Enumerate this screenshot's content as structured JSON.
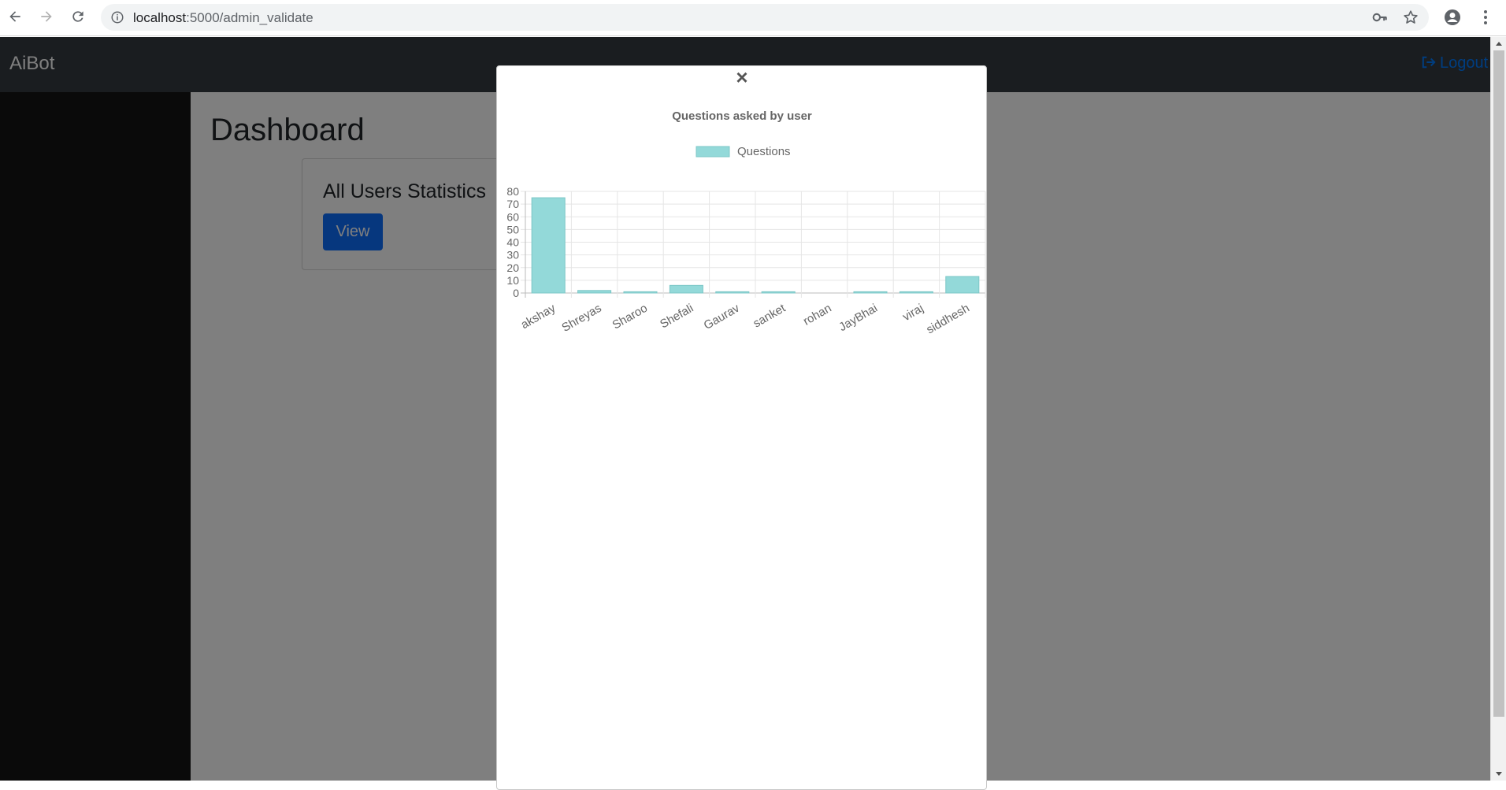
{
  "browser": {
    "url_host": "localhost",
    "url_path": ":5000/admin_validate"
  },
  "navbar": {
    "brand": "AiBot",
    "logout_label": "Logout"
  },
  "dashboard": {
    "title": "Dashboard",
    "card_title": "All Users Statistics",
    "view_label": "View"
  },
  "modal": {
    "close_glyph": "×"
  },
  "chart_data": {
    "type": "bar",
    "title": "Questions asked by user",
    "xlabel": "",
    "ylabel": "",
    "ylim": [
      0,
      80
    ],
    "yticks": [
      0,
      10,
      20,
      30,
      40,
      50,
      60,
      70,
      80
    ],
    "grid": true,
    "legend_position": "top",
    "categories": [
      "akshay",
      "Shreyas",
      "Sharoo",
      "Shefali",
      "Gaurav",
      "sanket",
      "rohan",
      "JayBhai",
      "viraj",
      "siddhesh"
    ],
    "series": [
      {
        "name": "Questions",
        "values": [
          75,
          2,
          1,
          6,
          1,
          1,
          0,
          1,
          1,
          13
        ],
        "color": "#93d9d9",
        "border_color": "#7cc7c7"
      }
    ]
  },
  "colors": {
    "navbar_bg": "#343a40",
    "primary": "#0d6efd",
    "link": "#007bff"
  }
}
